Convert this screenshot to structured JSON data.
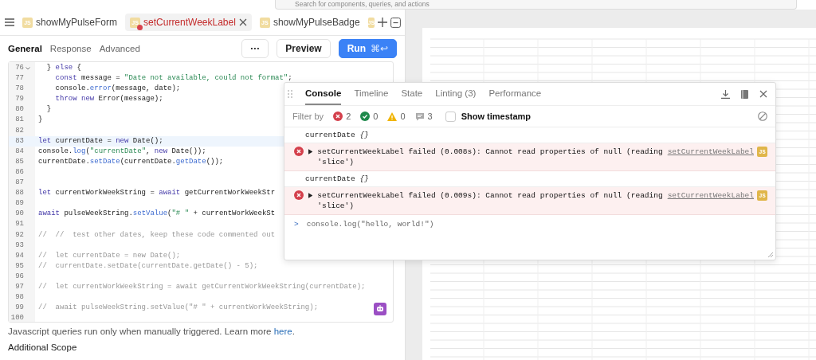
{
  "search": {
    "placeholder": "Search for components, queries, and actions"
  },
  "tabs": [
    {
      "label": "showMyPulseForm",
      "badge": "JS",
      "selected": false,
      "error": false
    },
    {
      "label": "setCurrentWeekLabel",
      "badge": "JS",
      "selected": true,
      "error": true
    },
    {
      "label": "showMyPulseBadge",
      "badge": "JS",
      "selected": false,
      "error": false
    }
  ],
  "overflow_tab_badge": "JS",
  "sub_tabs": [
    {
      "label": "General",
      "selected": true
    },
    {
      "label": "Response",
      "selected": false
    },
    {
      "label": "Advanced",
      "selected": false
    }
  ],
  "more_button": "···",
  "preview_button": "Preview",
  "run_button": {
    "label": "Run",
    "shortcut": "⌘↩"
  },
  "code": {
    "lines": [
      {
        "number": "76",
        "foldable": true,
        "active": false,
        "segments": [
          {
            "text": "  } ",
            "kind": "plain"
          },
          {
            "text": "else",
            "kind": "keyword"
          },
          {
            "text": " {",
            "kind": "plain"
          }
        ]
      },
      {
        "number": "77",
        "foldable": false,
        "active": false,
        "segments": [
          {
            "text": "    const",
            "kind": "keyword"
          },
          {
            "text": " message = ",
            "kind": "plain"
          },
          {
            "text": "\"Date not available, could not format\"",
            "kind": "string"
          },
          {
            "text": ";",
            "kind": "plain"
          }
        ]
      },
      {
        "number": "78",
        "foldable": false,
        "active": false,
        "segments": [
          {
            "text": "    console.",
            "kind": "plain"
          },
          {
            "text": "error",
            "kind": "method"
          },
          {
            "text": "(message, date);",
            "kind": "plain"
          }
        ]
      },
      {
        "number": "79",
        "foldable": false,
        "active": false,
        "segments": [
          {
            "text": "    throw new",
            "kind": "keyword"
          },
          {
            "text": " Error(message);",
            "kind": "plain"
          }
        ]
      },
      {
        "number": "80",
        "foldable": false,
        "active": false,
        "segments": [
          {
            "text": "  }",
            "kind": "plain"
          }
        ]
      },
      {
        "number": "81",
        "foldable": false,
        "active": false,
        "segments": [
          {
            "text": "}",
            "kind": "plain"
          }
        ]
      },
      {
        "number": "82",
        "foldable": false,
        "active": false
      },
      {
        "number": "83",
        "foldable": false,
        "active": true,
        "segments": [
          {
            "text": "let",
            "kind": "keyword"
          },
          {
            "text": " currentDate = ",
            "kind": "plain"
          },
          {
            "text": "new",
            "kind": "keyword"
          },
          {
            "text": " Date();",
            "kind": "plain"
          }
        ]
      },
      {
        "number": "84",
        "foldable": false,
        "active": false,
        "segments": [
          {
            "text": "console.",
            "kind": "plain"
          },
          {
            "text": "log",
            "kind": "method"
          },
          {
            "text": "(",
            "kind": "plain"
          },
          {
            "text": "\"currentDate\"",
            "kind": "string"
          },
          {
            "text": ", ",
            "kind": "plain"
          },
          {
            "text": "new",
            "kind": "keyword"
          },
          {
            "text": " Date());",
            "kind": "plain"
          }
        ]
      },
      {
        "number": "85",
        "foldable": false,
        "active": false,
        "segments": [
          {
            "text": "currentDate.",
            "kind": "plain"
          },
          {
            "text": "setDate",
            "kind": "method"
          },
          {
            "text": "(currentDate.",
            "kind": "plain"
          },
          {
            "text": "getDate",
            "kind": "method"
          },
          {
            "text": "());",
            "kind": "plain"
          }
        ]
      },
      {
        "number": "86",
        "foldable": false,
        "active": false
      },
      {
        "number": "87",
        "foldable": false,
        "active": false
      },
      {
        "number": "88",
        "foldable": false,
        "active": false,
        "segments": [
          {
            "text": "let",
            "kind": "keyword"
          },
          {
            "text": " currentWorkWeekString = ",
            "kind": "plain"
          },
          {
            "text": "await",
            "kind": "keyword"
          },
          {
            "text": " getCurrentWorkWeekStr",
            "kind": "plain"
          }
        ]
      },
      {
        "number": "89",
        "foldable": false,
        "active": false
      },
      {
        "number": "90",
        "foldable": false,
        "active": false,
        "segments": [
          {
            "text": "await",
            "kind": "keyword"
          },
          {
            "text": " pulseWeekString.",
            "kind": "plain"
          },
          {
            "text": "setValue",
            "kind": "method"
          },
          {
            "text": "(",
            "kind": "plain"
          },
          {
            "text": "\"# \"",
            "kind": "string"
          },
          {
            "text": " + currentWorkWeekSt",
            "kind": "plain"
          }
        ]
      },
      {
        "number": "91",
        "foldable": false,
        "active": false
      },
      {
        "number": "92",
        "foldable": false,
        "active": false,
        "segments": [
          {
            "text": "//  //  test other dates, keep these code commented out",
            "kind": "comment"
          }
        ]
      },
      {
        "number": "93",
        "foldable": false,
        "active": false
      },
      {
        "number": "94",
        "foldable": false,
        "active": false,
        "segments": [
          {
            "text": "//  let currentDate = new Date();",
            "kind": "comment"
          }
        ]
      },
      {
        "number": "95",
        "foldable": false,
        "active": false,
        "segments": [
          {
            "text": "//  currentDate.setDate(currentDate.getDate() - 5);",
            "kind": "comment"
          }
        ]
      },
      {
        "number": "96",
        "foldable": false,
        "active": false
      },
      {
        "number": "97",
        "foldable": false,
        "active": false,
        "segments": [
          {
            "text": "//  let currentWorkWeekString = await getCurrentWorkWeekString(currentDate);",
            "kind": "comment"
          }
        ]
      },
      {
        "number": "98",
        "foldable": false,
        "active": false
      },
      {
        "number": "99",
        "foldable": false,
        "active": false,
        "segments": [
          {
            "text": "//  await pulseWeekString.setValue(\"# \" + currentWorkWeekString);",
            "kind": "comment"
          }
        ]
      },
      {
        "number": "100",
        "foldable": false,
        "active": false
      }
    ]
  },
  "note": {
    "text": "Javascript queries run only when manually triggered. Learn more ",
    "link": "here",
    "end": "."
  },
  "section_heading": "Additional Scope",
  "console": {
    "tabs": [
      {
        "label": "Console",
        "selected": true
      },
      {
        "label": "Timeline",
        "selected": false
      },
      {
        "label": "State",
        "selected": false
      },
      {
        "label": "Linting (3)",
        "selected": false
      },
      {
        "label": "Performance",
        "selected": false
      }
    ],
    "filter_label": "Filter by",
    "filters": [
      {
        "kind": "error",
        "count": "2"
      },
      {
        "kind": "success",
        "count": "0"
      },
      {
        "kind": "warning",
        "count": "0"
      },
      {
        "kind": "message",
        "count": "3"
      }
    ],
    "show_timestamp": {
      "label": "Show timestamp",
      "checked": false
    },
    "entries": [
      {
        "kind": "log",
        "text": "currentDate",
        "value": "{}"
      },
      {
        "kind": "error",
        "text": "setCurrentWeekLabel failed (0.008s): Cannot read properties of null (reading 'slice')",
        "source": "setCurrentWeekLabel",
        "badge": "JS"
      },
      {
        "kind": "log",
        "text": "currentDate",
        "value": "{}"
      },
      {
        "kind": "error",
        "text": "setCurrentWeekLabel failed (0.009s): Cannot read properties of null (reading 'slice')",
        "source": "setCurrentWeekLabel",
        "badge": "JS"
      }
    ],
    "prompt": ">",
    "input": "console.log(\"hello, world!\")"
  }
}
